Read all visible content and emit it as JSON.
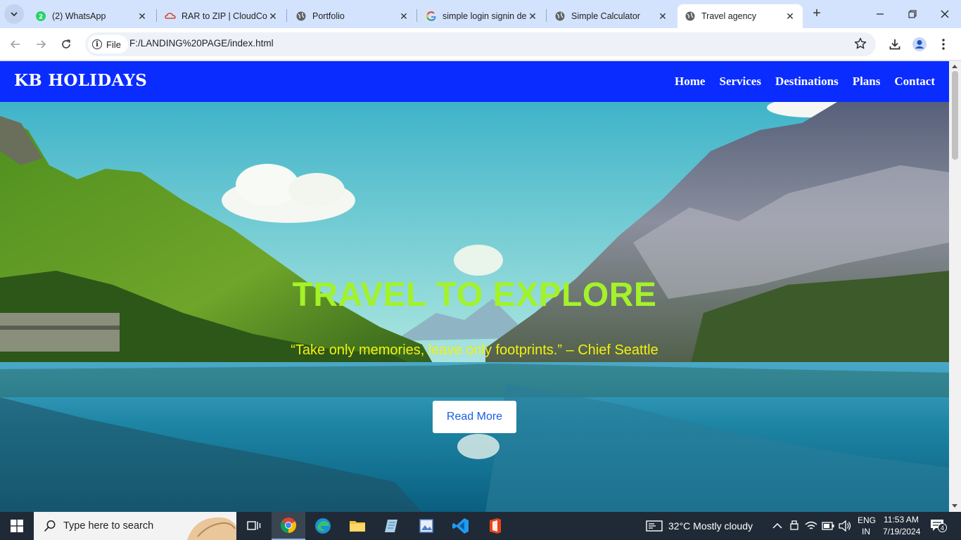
{
  "browser": {
    "tabs": [
      {
        "title": "(2) WhatsApp",
        "icon": "whatsapp-icon"
      },
      {
        "title": "RAR to ZIP | CloudConvert",
        "icon": "cloudconvert-icon"
      },
      {
        "title": "Portfolio",
        "icon": "globe-icon"
      },
      {
        "title": "simple login signin design",
        "icon": "google-icon"
      },
      {
        "title": "Simple Calculator",
        "icon": "globe-icon"
      },
      {
        "title": "Travel agency",
        "icon": "globe-icon",
        "active": true
      }
    ],
    "security_chip": "File",
    "url": "F:/LANDING%20PAGE/index.html"
  },
  "page": {
    "brand": "KB HOLIDAYS",
    "nav": [
      "Home",
      "Services",
      "Destinations",
      "Plans",
      "Contact"
    ],
    "hero": {
      "title": "TRAVEL TO EXPLORE",
      "quote": "“Take only memories, leave only footprints.” – Chief Seattle",
      "button": "Read More"
    },
    "colors": {
      "nav_bg": "#0a2cff",
      "title": "#a3f22a",
      "quote": "#f2f20e",
      "button_text": "#1a5ee0"
    }
  },
  "taskbar": {
    "search_placeholder": "Type here to search",
    "weather": "32°C  Mostly cloudy",
    "language": "ENG",
    "region": "IN",
    "time": "11:53 AM",
    "date": "7/19/2024",
    "notifications": "4"
  }
}
